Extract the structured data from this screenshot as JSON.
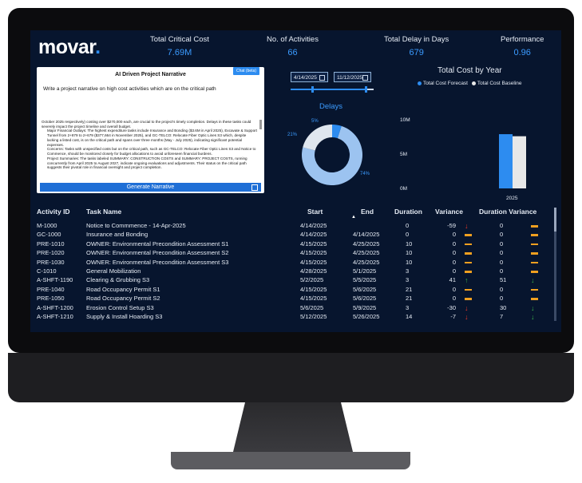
{
  "logo": "movar",
  "kpis": [
    {
      "label": "Total Critical Cost",
      "value": "7.69M"
    },
    {
      "label": "No. of Activities",
      "value": "66"
    },
    {
      "label": "Total Delay in Days",
      "value": "679"
    },
    {
      "label": "Performance",
      "value": "0.96"
    }
  ],
  "ai": {
    "title": "AI Driven Project Narrative",
    "chat_button": "Chat (beta)",
    "prompt": "Write a project narrative on high cost activities which are on the critical path",
    "narrative_intro": "October 2025 respectively) costing over $270,000 each, are crucial to the project's timely completion. Delays in these tasks could severely impact the project timeline and overall budget.",
    "bullets": [
      "Major Financial Outlays: The highest expenditure tasks include Insurance and Bonding ($3.6M in April 2025), Excavate & Support Tunnel from 2+879 to 2+679 ($377,664 in November 2025), and GC-TELCO: Relocate Fiber Optic Lines S3 which, despite lacking a listed cost, is on the critical path and spans over three months (May - July 2025), indicating significant potential expenses.",
      "Concerns: Tasks with unspecified costs but on the critical path, such as GC-TELCO: Relocate Fiber Optic Lines S3 and Notice to Commence, should be monitored closely for budget allocations to avoid unforeseen financial burdens.",
      "Project Summaries: The tasks labeled SUMMARY: CONSTRUCTION COSTS and SUMMARY: PROJECT COSTS, running concurrently from April 2025 to August 2027, indicate ongoing evaluations and adjustments. Their status on the critical path suggests their pivotal role in financial oversight and project completion."
    ],
    "generate_button": "Generate Narrative"
  },
  "filters": {
    "start_date": "4/14/2025",
    "end_date": "11/12/2025",
    "range_start": 0.25,
    "range_end": 0.08
  },
  "delays": {
    "title": "Delays",
    "label_small": "5%",
    "label_mid": "21%",
    "label_large": "74%"
  },
  "chart_data": [
    {
      "type": "pie",
      "title": "Delays",
      "slices": [
        {
          "value": 74,
          "color": "#9cc3f0"
        },
        {
          "value": 21,
          "color": "#dfe6ee"
        },
        {
          "value": 5,
          "color": "#2d8cf0"
        }
      ]
    },
    {
      "type": "bar",
      "title": "Total Cost by Year",
      "categories": [
        "2025"
      ],
      "series": [
        {
          "name": "Total Cost Forecast",
          "values": [
            7900000
          ],
          "color": "#2d8cf0"
        },
        {
          "name": "Total Cost Baseline",
          "values": [
            7600000
          ],
          "color": "#e8e8e8"
        }
      ],
      "yticks": [
        "10M",
        "5M",
        "0M"
      ],
      "ylim": [
        0,
        10000000
      ]
    }
  ],
  "cost": {
    "title": "Total Cost by Year",
    "legend_forecast": "Total Cost Forecast",
    "legend_baseline": "Total Cost Baseline",
    "y10": "10M",
    "y5": "5M",
    "y0": "0M",
    "x2025": "2025"
  },
  "table": {
    "headers": [
      "Activity ID",
      "Task Name",
      "Start",
      "End",
      "Duration",
      "Variance",
      "Duration Variance"
    ],
    "rows": [
      {
        "id": "M-1000",
        "task": "Notice to Commmence - 14-Apr-2025",
        "start": "4/14/2025",
        "end": "",
        "duration": "0",
        "variance": "-59",
        "var_icon": "down",
        "dvar": "0",
        "dvar_icon": "flat"
      },
      {
        "id": "GC-1000",
        "task": "Insurance and Bonding",
        "start": "4/14/2025",
        "end": "4/14/2025",
        "duration": "0",
        "variance": "0",
        "var_icon": "flat",
        "dvar": "0",
        "dvar_icon": "flat"
      },
      {
        "id": "PRE-1010",
        "task": "OWNER: Environmental Precondition Assessment S1",
        "start": "4/15/2025",
        "end": "4/25/2025",
        "duration": "10",
        "variance": "0",
        "var_icon": "flat",
        "dvar": "0",
        "dvar_icon": "flat"
      },
      {
        "id": "PRE-1020",
        "task": "OWNER: Environmental Precondition Assessment S2",
        "start": "4/15/2025",
        "end": "4/25/2025",
        "duration": "10",
        "variance": "0",
        "var_icon": "flat",
        "dvar": "0",
        "dvar_icon": "flat"
      },
      {
        "id": "PRE-1030",
        "task": "OWNER: Environmental Precondition Assessment S3",
        "start": "4/15/2025",
        "end": "4/25/2025",
        "duration": "10",
        "variance": "0",
        "var_icon": "flat",
        "dvar": "0",
        "dvar_icon": "flat"
      },
      {
        "id": "C-1010",
        "task": "General Mobilization",
        "start": "4/28/2025",
        "end": "5/1/2025",
        "duration": "3",
        "variance": "0",
        "var_icon": "flat",
        "dvar": "0",
        "dvar_icon": "flat"
      },
      {
        "id": "A-SHFT-1190",
        "task": "Clearing & Grubbing S3",
        "start": "5/2/2025",
        "end": "5/5/2025",
        "duration": "3",
        "variance": "41",
        "var_icon": "up",
        "dvar": "51",
        "dvar_icon": "down-green"
      },
      {
        "id": "PRE-1040",
        "task": "Road Occupancy Permit S1",
        "start": "4/15/2025",
        "end": "5/6/2025",
        "duration": "21",
        "variance": "0",
        "var_icon": "flat",
        "dvar": "0",
        "dvar_icon": "flat"
      },
      {
        "id": "PRE-1050",
        "task": "Road Occupancy Permit S2",
        "start": "4/15/2025",
        "end": "5/6/2025",
        "duration": "21",
        "variance": "0",
        "var_icon": "flat",
        "dvar": "0",
        "dvar_icon": "flat"
      },
      {
        "id": "A-SHFT-1200",
        "task": "Erosion Control Setup S3",
        "start": "5/6/2025",
        "end": "5/9/2025",
        "duration": "3",
        "variance": "-30",
        "var_icon": "down",
        "dvar": "30",
        "dvar_icon": "down-green"
      },
      {
        "id": "A-SHFT-1210",
        "task": "Supply & Install Hoarding S3",
        "start": "5/12/2025",
        "end": "5/26/2025",
        "duration": "14",
        "variance": "-7",
        "var_icon": "down",
        "dvar": "7",
        "dvar_icon": "down-green"
      }
    ]
  },
  "colors": {
    "accent": "#2d8cf0",
    "background": "#07152e",
    "down": "#e8392a",
    "up": "#3bb54a",
    "flat": "#f0a020"
  }
}
